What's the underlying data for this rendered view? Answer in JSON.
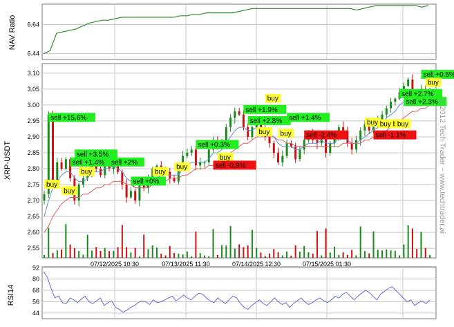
{
  "watermark": "© 2012 Tech Trader ~ www.techtrader.ai",
  "panels": {
    "nav": {
      "ylabel": "NAV Ratio",
      "yticks": [
        "6.64",
        "6.44"
      ]
    },
    "price": {
      "ylabel": "XRP-USDT",
      "yticks": [
        "3.10",
        "3.05",
        "3.00",
        "2.95",
        "2.90",
        "2.85",
        "2.80",
        "2.75",
        "2.70",
        "2.65",
        "2.60",
        "2.55"
      ]
    },
    "rsi": {
      "ylabel": "RSI14",
      "yticks": [
        "92",
        "80",
        "68",
        "56",
        "44"
      ]
    }
  },
  "x_ticks": [
    "07/12/2025 10:30",
    "07/13/2025 11:30",
    "07/14/2025 12:30",
    "07/15/2025 01:30"
  ],
  "colors": {
    "up": "#1a8a1a",
    "down": "#cc1111",
    "nav_line": "#2e8b2e",
    "ma_fast": "#5b8fd8",
    "ma_slow": "#d96060",
    "rsi_line": "#6a6ad8",
    "grid": "#c8c8c8",
    "sell_bg": "#22ee22",
    "buy_bg": "#ffff33",
    "loss_bg": "#ee1111"
  },
  "chart_data": [
    {
      "type": "line",
      "title": "",
      "ylabel": "NAV Ratio",
      "ylim": [
        6.4,
        6.78
      ],
      "values": [
        6.44,
        6.46,
        6.58,
        6.59,
        6.6,
        6.61,
        6.63,
        6.65,
        6.66,
        6.67,
        6.67,
        6.68,
        6.69,
        6.69,
        6.69,
        6.69,
        6.69,
        6.69,
        6.69,
        6.69,
        6.69,
        6.7,
        6.7,
        6.71,
        6.71,
        6.72,
        6.72,
        6.72,
        6.72,
        6.72,
        6.73,
        6.74,
        6.75,
        6.75,
        6.75,
        6.75,
        6.75,
        6.75,
        6.75,
        6.75,
        6.75,
        6.75,
        6.75,
        6.75,
        6.75,
        6.75,
        6.75,
        6.75,
        6.74,
        6.75,
        6.76,
        6.77,
        6.77,
        6.77,
        6.77,
        6.77,
        6.77,
        6.77,
        6.76,
        6.77
      ]
    },
    {
      "type": "line",
      "title": "",
      "ylabel": "XRP-USDT",
      "ylim": [
        2.52,
        3.13
      ],
      "series": [
        {
          "values": [
            2.72,
            2.97,
            2.76,
            2.82,
            2.8,
            2.83,
            2.77,
            2.7,
            2.75,
            2.77,
            2.79,
            2.84,
            2.8,
            2.78,
            2.82,
            2.8,
            2.82,
            2.79,
            2.75,
            2.71,
            2.73,
            2.7,
            2.75,
            2.74,
            2.77,
            2.8,
            2.81,
            2.8,
            2.79,
            2.77,
            2.76,
            2.8,
            2.84,
            2.85,
            2.86,
            2.81,
            2.82,
            2.82,
            2.86,
            2.89,
            2.87,
            2.88,
            2.93,
            2.96,
            2.98,
            2.97,
            2.93,
            2.9,
            2.93,
            2.95,
            2.93,
            2.9,
            2.88,
            2.85,
            2.82,
            2.84,
            2.88,
            2.87,
            2.83,
            2.86,
            2.89,
            2.91,
            2.89,
            2.88,
            2.9,
            2.85,
            2.88,
            2.9,
            2.93,
            2.92,
            2.88,
            2.86,
            2.89,
            2.92,
            2.94,
            2.92,
            2.94,
            2.95,
            2.97,
            2.99,
            3.01,
            3.02,
            3.04,
            3.06,
            3.08,
            3.04,
            3.02,
            3.05,
            3.01,
            3.05
          ]
        },
        {
          "values": [
            2.65,
            2.7,
            2.74,
            2.76,
            2.78,
            2.79,
            2.79,
            2.77,
            2.76,
            2.76,
            2.77,
            2.79,
            2.79,
            2.79,
            2.8,
            2.8,
            2.81,
            2.8,
            2.79,
            2.77,
            2.76,
            2.74,
            2.74,
            2.74,
            2.75,
            2.76,
            2.77,
            2.78,
            2.78,
            2.78,
            2.78,
            2.78,
            2.8,
            2.81,
            2.82,
            2.82,
            2.82,
            2.82,
            2.83,
            2.85,
            2.85,
            2.86,
            2.88,
            2.9,
            2.92,
            2.93,
            2.93,
            2.92,
            2.92,
            2.93,
            2.93,
            2.92,
            2.91,
            2.9,
            2.88,
            2.87,
            2.87,
            2.87,
            2.86,
            2.86,
            2.87,
            2.88,
            2.88,
            2.88,
            2.89,
            2.88,
            2.88,
            2.88,
            2.9,
            2.9,
            2.89,
            2.88,
            2.88,
            2.89,
            2.9,
            2.91,
            2.92,
            2.93,
            2.94,
            2.96,
            2.97,
            2.98,
            3.0,
            3.01,
            3.03,
            3.03,
            3.03,
            3.03,
            3.03,
            3.03
          ]
        },
        {
          "values": [
            2.6,
            2.62,
            2.65,
            2.67,
            2.69,
            2.7,
            2.71,
            2.71,
            2.71,
            2.72,
            2.72,
            2.73,
            2.74,
            2.74,
            2.75,
            2.75,
            2.76,
            2.76,
            2.76,
            2.75,
            2.75,
            2.74,
            2.74,
            2.74,
            2.74,
            2.75,
            2.75,
            2.76,
            2.76,
            2.77,
            2.77,
            2.77,
            2.78,
            2.78,
            2.79,
            2.8,
            2.8,
            2.8,
            2.81,
            2.81,
            2.82,
            2.83,
            2.84,
            2.85,
            2.86,
            2.87,
            2.88,
            2.88,
            2.89,
            2.9,
            2.9,
            2.9,
            2.9,
            2.9,
            2.89,
            2.89,
            2.88,
            2.88,
            2.87,
            2.87,
            2.87,
            2.87,
            2.87,
            2.87,
            2.87,
            2.87,
            2.87,
            2.87,
            2.87,
            2.88,
            2.88,
            2.88,
            2.88,
            2.88,
            2.89,
            2.89,
            2.9,
            2.9,
            2.91,
            2.92,
            2.93,
            2.94,
            2.95,
            2.96,
            2.97,
            2.98,
            2.98,
            2.99,
            2.99,
            3.0
          ]
        }
      ],
      "signals": [
        {
          "label": "sell +15.6%",
          "kind": "sell",
          "x": 1,
          "y": 2.96
        },
        {
          "label": "buy",
          "kind": "buy",
          "x": 0,
          "y": 2.75
        },
        {
          "label": "buy",
          "kind": "buy",
          "x": 4,
          "y": 2.73
        },
        {
          "label": "sell +3.5%",
          "kind": "sell",
          "x": 7,
          "y": 2.845
        },
        {
          "label": "sell +1.4%",
          "kind": "sell",
          "x": 6,
          "y": 2.82
        },
        {
          "label": "buy",
          "kind": "buy",
          "x": 8,
          "y": 2.79
        },
        {
          "label": "sell +2%",
          "kind": "sell",
          "x": 15,
          "y": 2.82
        },
        {
          "label": "sell +0%",
          "kind": "sell",
          "x": 20,
          "y": 2.76
        },
        {
          "label": "buy",
          "kind": "buy",
          "x": 25,
          "y": 2.79
        },
        {
          "label": "buy",
          "kind": "buy",
          "x": 30,
          "y": 2.805
        },
        {
          "label": "sell +0.3%",
          "kind": "sell",
          "x": 35,
          "y": 2.875
        },
        {
          "label": "buy",
          "kind": "buy",
          "x": 40,
          "y": 2.835
        },
        {
          "label": "sell -0.9%",
          "kind": "loss",
          "x": 39,
          "y": 2.81
        },
        {
          "label": "sell +1.9%",
          "kind": "sell",
          "x": 46,
          "y": 2.985
        },
        {
          "label": "sell +2.8%",
          "kind": "sell",
          "x": 47,
          "y": 2.95
        },
        {
          "label": "buy",
          "kind": "buy",
          "x": 49,
          "y": 2.915
        },
        {
          "label": "buy",
          "kind": "buy",
          "x": 51,
          "y": 3.02
        },
        {
          "label": "sell +1.4%",
          "kind": "sell",
          "x": 56,
          "y": 2.96
        },
        {
          "label": "buy",
          "kind": "buy",
          "x": 54,
          "y": 2.91
        },
        {
          "label": "sell -2.4%",
          "kind": "loss",
          "x": 60,
          "y": 2.905
        },
        {
          "label": "buy",
          "kind": "buy",
          "x": 74,
          "y": 2.945
        },
        {
          "label": "buy",
          "kind": "buy",
          "x": 77,
          "y": 2.94
        },
        {
          "label": "sell -1.1%",
          "kind": "loss",
          "x": 76,
          "y": 2.905
        },
        {
          "label": "buy",
          "kind": "buy",
          "x": 80,
          "y": 2.94
        },
        {
          "label": "sell +2.7%",
          "kind": "sell",
          "x": 82,
          "y": 3.035
        },
        {
          "label": "sell +2.3%",
          "kind": "sell",
          "x": 83,
          "y": 3.01
        },
        {
          "label": "buy",
          "kind": "buy",
          "x": 81,
          "y": 2.94
        },
        {
          "label": "sell +0.5%",
          "kind": "sell",
          "x": 87,
          "y": 3.095
        },
        {
          "label": "buy",
          "kind": "buy",
          "x": 88,
          "y": 3.07
        }
      ]
    },
    {
      "type": "line",
      "title": "",
      "ylabel": "RSI14",
      "ylim": [
        38,
        93
      ],
      "values": [
        88,
        82,
        70,
        60,
        62,
        55,
        54,
        60,
        58,
        55,
        59,
        62,
        56,
        54,
        57,
        60,
        52,
        55,
        57,
        50,
        48,
        45,
        47,
        50,
        52,
        55,
        57,
        56,
        53,
        58,
        55,
        56,
        58,
        60,
        62,
        57,
        60,
        63,
        60,
        58,
        62,
        65,
        64,
        60,
        57,
        55,
        60,
        57,
        54,
        58,
        62,
        60,
        54,
        50,
        48,
        52,
        55,
        58,
        54,
        52,
        56,
        60,
        56,
        53,
        55,
        50,
        54,
        57,
        60,
        56,
        53,
        55,
        58,
        60,
        57,
        55,
        58,
        62,
        60,
        64,
        66,
        62,
        58,
        62,
        65,
        68,
        66,
        62,
        58,
        64,
        67,
        70,
        72,
        68,
        64,
        60,
        56,
        58,
        52,
        55,
        57,
        54,
        58
      ]
    }
  ]
}
